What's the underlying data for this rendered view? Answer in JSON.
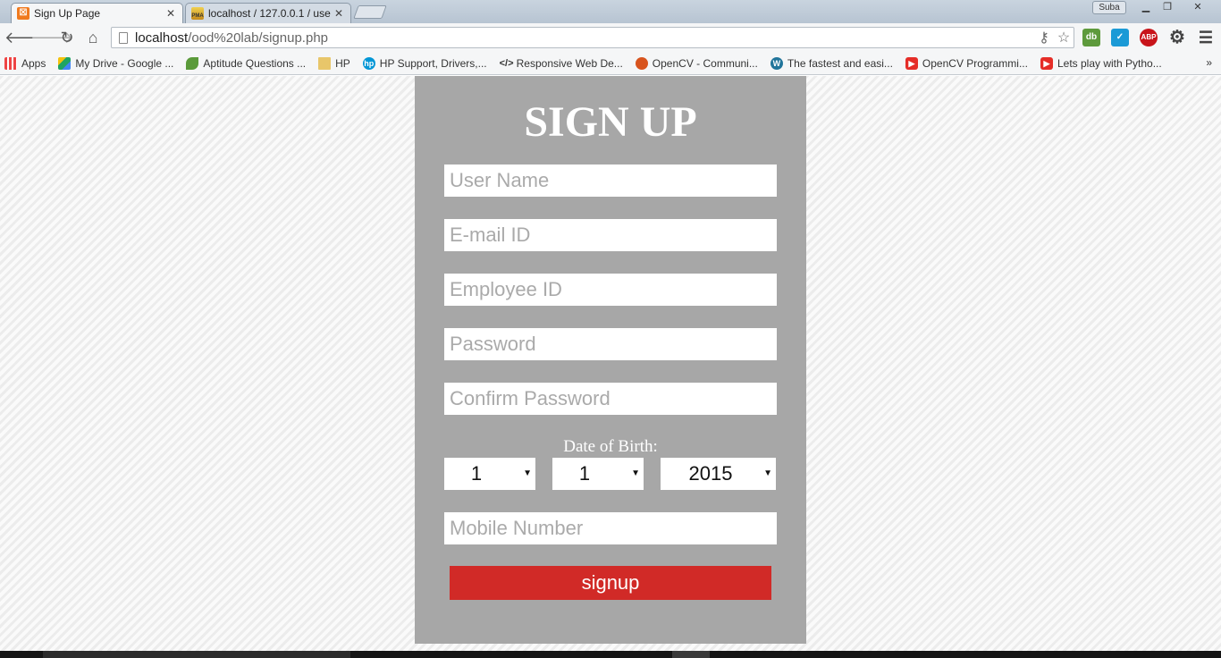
{
  "browser": {
    "tabs": [
      {
        "title": "Sign Up Page",
        "icon": "xampp-icon",
        "active": true
      },
      {
        "title": "localhost / 127.0.0.1 / use",
        "icon": "phpmyadmin-icon",
        "active": false
      }
    ],
    "profile_name": "Suba",
    "url_host": "localhost",
    "url_path": "/ood%20lab/signup.php",
    "bookmarks": [
      {
        "label": "Apps",
        "icon": "apps-grid-icon"
      },
      {
        "label": "My Drive - Google ...",
        "icon": "google-drive-icon"
      },
      {
        "label": "Aptitude Questions ...",
        "icon": "leaf-icon"
      },
      {
        "label": "HP",
        "icon": "folder-icon"
      },
      {
        "label": "HP Support, Drivers,...",
        "icon": "hp-icon"
      },
      {
        "label": "Responsive Web De...",
        "icon": "code-icon"
      },
      {
        "label": "OpenCV - Communi...",
        "icon": "opencv-icon"
      },
      {
        "label": "The fastest and easi...",
        "icon": "wordpress-icon"
      },
      {
        "label": "OpenCV Programmi...",
        "icon": "youtube-icon"
      },
      {
        "label": "Lets play with Pytho...",
        "icon": "youtube-icon"
      }
    ],
    "bookmarks_more": "»"
  },
  "form": {
    "title": "SIGN UP",
    "fields": {
      "username_placeholder": "User Name",
      "email_placeholder": "E-mail ID",
      "employee_placeholder": "Employee ID",
      "password_placeholder": "Password",
      "confirm_placeholder": "Confirm Password",
      "mobile_placeholder": "Mobile Number"
    },
    "dob_label": "Date of Birth:",
    "dob": {
      "day": "1",
      "month": "1",
      "year": "2015"
    },
    "submit_label": "signup"
  },
  "colors": {
    "card_bg": "#a7a7a7",
    "button_bg": "#d12a27",
    "text_white": "#ffffff"
  }
}
